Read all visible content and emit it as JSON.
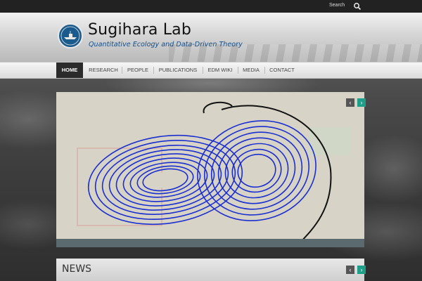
{
  "topbar": {
    "search_label": "Search",
    "search_icon": "search-icon"
  },
  "header": {
    "title": "Sugihara Lab",
    "tagline": "Quantitative Ecology and Data-Driven Theory",
    "logo_icon": "lab-logo-icon"
  },
  "nav": {
    "items": [
      {
        "label": "HOME",
        "active": true
      },
      {
        "label": "RESEARCH",
        "active": false
      },
      {
        "label": "PEOPLE",
        "active": false
      },
      {
        "label": "PUBLICATIONS",
        "active": false
      },
      {
        "label": "EDM WIKI",
        "active": false
      },
      {
        "label": "MEDIA",
        "active": false
      },
      {
        "label": "CONTACT",
        "active": false
      }
    ]
  },
  "slider": {
    "prev_icon": "chevron-left-icon",
    "next_icon": "chevron-right-icon",
    "image": "lorenz-attractor-sculpture"
  },
  "news": {
    "title": "NEWS",
    "prev_icon": "chevron-left-icon",
    "next_icon": "chevron-right-icon"
  },
  "colors": {
    "accent": "#1f9e8a",
    "nav_active_bg": "#2b2b2b",
    "tagline": "#16508a",
    "attractor_blue": "#1b2fd0"
  }
}
